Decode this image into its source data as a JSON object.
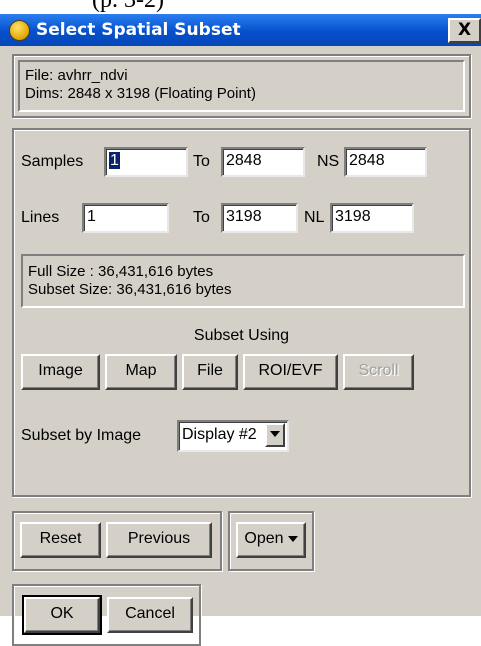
{
  "fragment_text": "(p.  3-2)",
  "window": {
    "title": "Select Spatial Subset",
    "close_glyph": "X",
    "icon": "envi-globe-icon"
  },
  "file_info": {
    "file_line": "File: avhrr_ndvi",
    "dims_line": "Dims: 2848 x 3198 (Floating Point)"
  },
  "samples": {
    "label": "Samples",
    "start": "1",
    "to_label": "To",
    "end": "2848",
    "ns_label": "NS",
    "ns": "2848"
  },
  "lines": {
    "label": "Lines",
    "start": "1",
    "to_label": "To",
    "end": "3198",
    "nl_label": "NL",
    "nl": "3198"
  },
  "size_info": {
    "full_line": "Full Size  : 36,431,616 bytes",
    "subset_line": "Subset Size: 36,431,616 bytes"
  },
  "subset_using": {
    "heading": "Subset Using",
    "buttons": [
      "Image",
      "Map",
      "File",
      "ROI/EVF",
      "Scroll"
    ],
    "disabled": [
      "Scroll"
    ]
  },
  "subset_by": {
    "label": "Subset by Image",
    "selected": "Display #2"
  },
  "actions": {
    "reset": "Reset",
    "previous": "Previous",
    "open": "Open",
    "ok": "OK",
    "cancel": "Cancel"
  }
}
